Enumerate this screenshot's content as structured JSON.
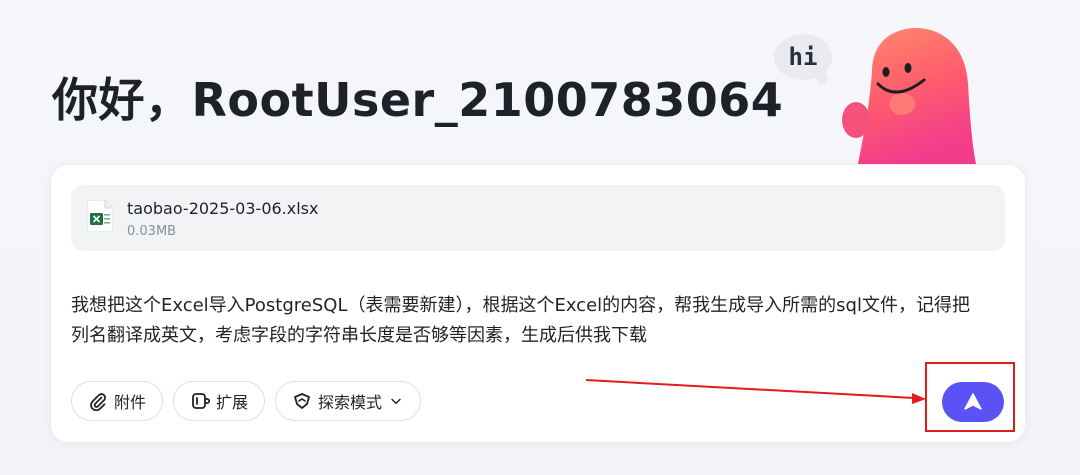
{
  "greeting": "你好，RootUser_2100783064",
  "mascot": {
    "bubble_text": "hi",
    "icon": "smiling-blob-mascot"
  },
  "attachment": {
    "file_name": "taobao-2025-03-06.xlsx",
    "file_size": "0.03MB",
    "icon": "excel-file-icon"
  },
  "prompt_text": "我想把这个Excel导入PostgreSQL（表需要新建），根据这个Excel的内容，帮我生成导入所需的sql文件，记得把列名翻译成英文，考虑字段的字符串长度是否够等因素，生成后供我下载",
  "toolbar": {
    "attach_label": "附件",
    "extend_label": "扩展",
    "explore_label": "探索模式"
  },
  "colors": {
    "accent": "#5a52f5",
    "annotation_red": "#e21b1b",
    "excel_green": "#1f7244"
  }
}
